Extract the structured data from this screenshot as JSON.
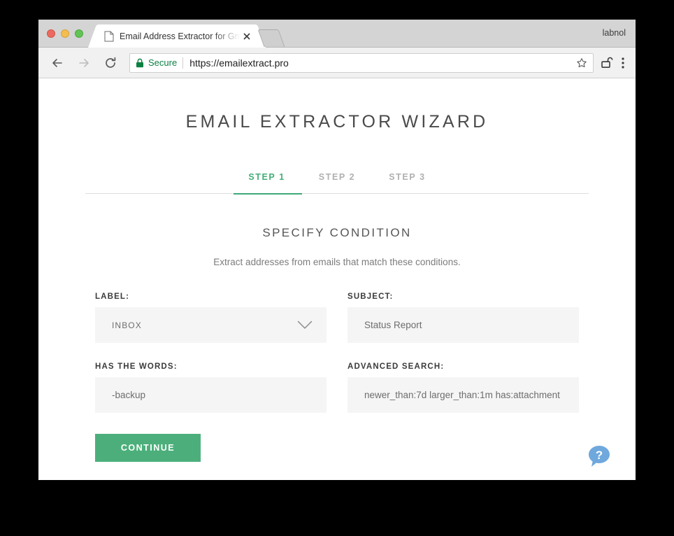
{
  "browser": {
    "traffic_lights": [
      "close",
      "minimize",
      "maximize"
    ],
    "tab": {
      "title": "Email Address Extractor for Gmail",
      "favicon_name": "page-icon",
      "close_icon": "close-icon"
    },
    "new_tab_label": "",
    "profile_name": "labnol",
    "toolbar": {
      "back_icon": "back-arrow-icon",
      "forward_icon": "forward-arrow-icon",
      "reload_icon": "reload-icon",
      "security_label": "Secure",
      "url": "https://emailextract.pro",
      "lock_icon": "lock-icon",
      "star_icon": "bookmark-star-icon",
      "extension_icon": "unlock-extension-icon",
      "menu_icon": "kebab-menu-icon"
    }
  },
  "page": {
    "title": "EMAIL EXTRACTOR WIZARD",
    "steps": [
      {
        "label": "STEP 1",
        "active": true
      },
      {
        "label": "STEP 2",
        "active": false
      },
      {
        "label": "STEP 3",
        "active": false
      }
    ],
    "section_title": "SPECIFY CONDITION",
    "section_subtitle": "Extract addresses from emails that match these conditions.",
    "fields": {
      "label": {
        "label": "LABEL:",
        "value": "INBOX",
        "type": "select",
        "chevron_icon": "chevron-down-icon"
      },
      "subject": {
        "label": "SUBJECT:",
        "value": "Status Report",
        "type": "text"
      },
      "has_the_words": {
        "label": "HAS THE WORDS:",
        "value": "-backup",
        "type": "text"
      },
      "advanced_search": {
        "label": "ADVANCED SEARCH:",
        "value": "newer_than:7d larger_than:1m has:attachment",
        "type": "text"
      }
    },
    "continue_label": "CONTINUE",
    "help_icon": "help-question-bubble-icon"
  },
  "colors": {
    "accent_green": "#4caf7b",
    "step_active_green": "#41ae77",
    "secure_green": "#0b8043",
    "help_blue": "#6fa8dc",
    "field_bg": "#f5f5f5"
  }
}
